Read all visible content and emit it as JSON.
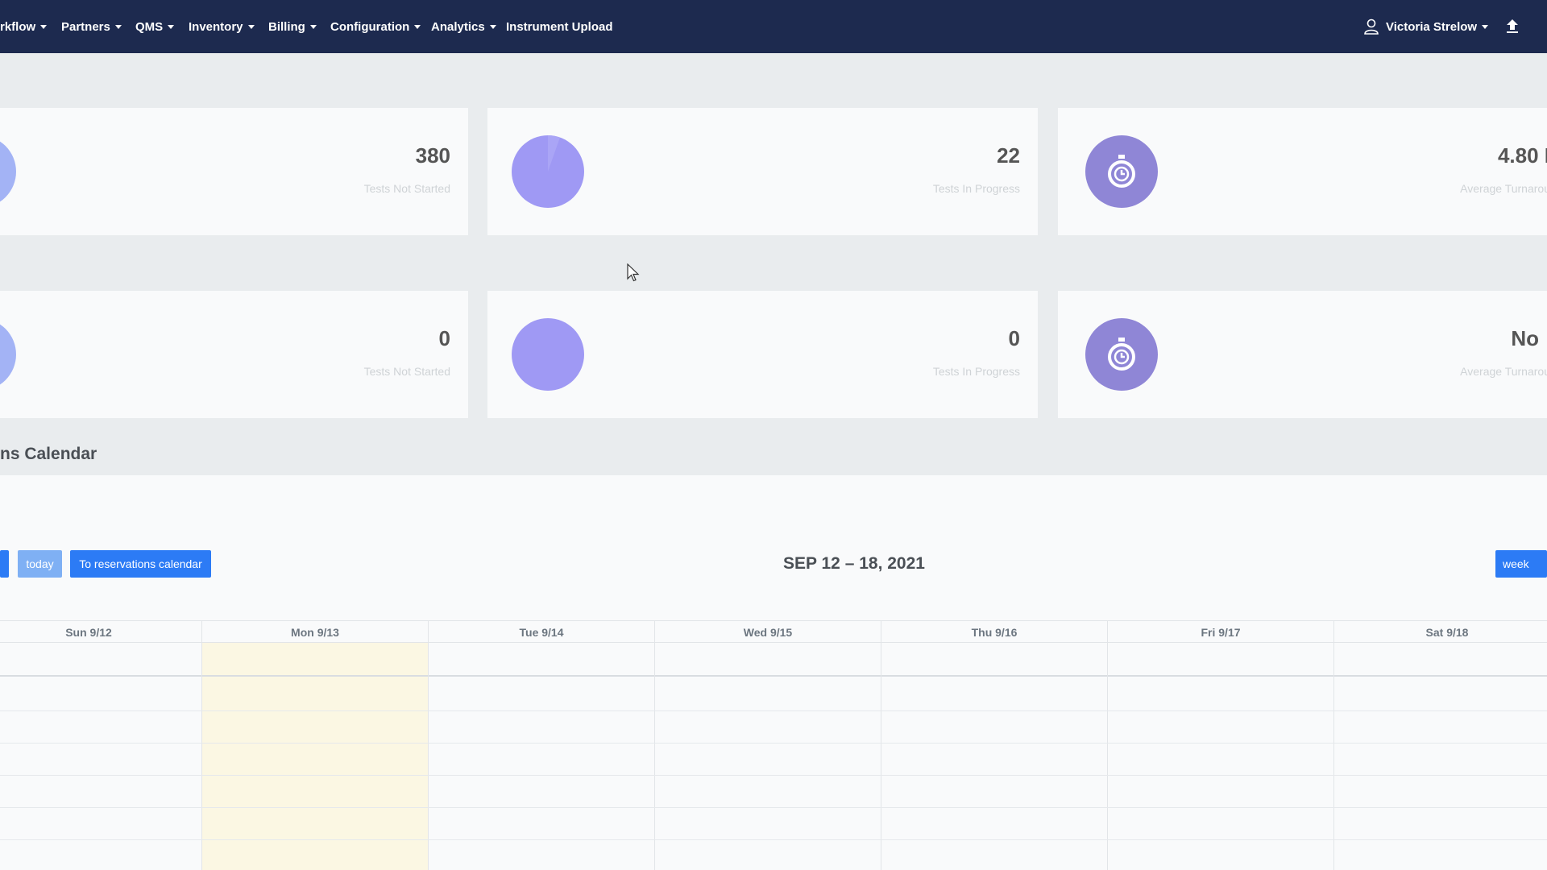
{
  "nav": {
    "items": [
      {
        "label": "rkflow"
      },
      {
        "label": "Partners"
      },
      {
        "label": "QMS"
      },
      {
        "label": "Inventory"
      },
      {
        "label": "Billing"
      },
      {
        "label": "Configuration"
      },
      {
        "label": "Analytics"
      },
      {
        "label": "Instrument Upload"
      }
    ],
    "user": "Victoria Strelow"
  },
  "cards_row1": [
    {
      "value": "380",
      "label": "Tests Not Started",
      "icon": "pie-chart-icon"
    },
    {
      "value": "22",
      "label": "Tests In Progress",
      "icon": "pie-chart-icon"
    },
    {
      "value": "4.80 I",
      "label": "Average Turnarou",
      "icon": "stopwatch-icon"
    }
  ],
  "cards_row2": [
    {
      "value": "0",
      "label": "Tests Not Started",
      "icon": "pie-chart-icon"
    },
    {
      "value": "0",
      "label": "Tests In Progress",
      "icon": "pie-chart-icon"
    },
    {
      "value": "No",
      "label": "Average Turnarou",
      "icon": "stopwatch-icon"
    }
  ],
  "calendar": {
    "title": "ns Calendar",
    "today_label": "today",
    "reservations_label": "To reservations calendar",
    "range": "SEP 12 – 18, 2021",
    "week_label": "week",
    "days": [
      "Sun 9/12",
      "Mon 9/13",
      "Tue 9/14",
      "Wed 9/15",
      "Thu 9/16",
      "Fri 9/17",
      "Sat 9/18"
    ],
    "today_index": 1
  },
  "colors": {
    "nav_bg": "#1d2a4f",
    "primary_button": "#2c7bf5",
    "today_button": "#7fb0f4",
    "today_highlight": "#fbf7e3",
    "stat_blue": "#a3b3f5",
    "stat_purple": "#9f99f4",
    "stat_timer": "#8f86d6"
  }
}
